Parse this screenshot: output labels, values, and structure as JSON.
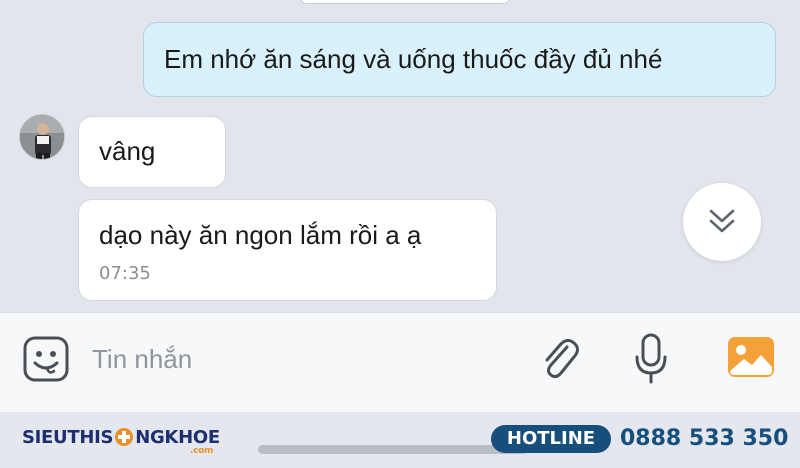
{
  "messages": {
    "sent_1": "Em nhớ ăn sáng và uống thuốc đầy đủ nhé",
    "received_1": "vâng",
    "received_2": "dạo này ăn ngon lắm rồi a ạ",
    "received_2_time": "07:35"
  },
  "composer": {
    "placeholder": "Tin nhắn",
    "icons": [
      "emoji-icon",
      "paperclip-icon",
      "microphone-icon",
      "photo-icon"
    ]
  },
  "footer": {
    "brand_part1": "SIEUTHIS",
    "brand_part2": "NGKHOE",
    "brand_suffix": ".com",
    "hotline_label": "HOTLINE",
    "hotline_number": "0888 533 350"
  },
  "colors": {
    "chat_background": "#e2e6ec",
    "sent_bubble": "#d8f1fc",
    "received_bubble": "#ffffff",
    "photo_icon": "#f5a13a",
    "hotline_blue": "#174f7c",
    "brand_navy": "#1d2f6f",
    "brand_orange": "#e8912b"
  }
}
